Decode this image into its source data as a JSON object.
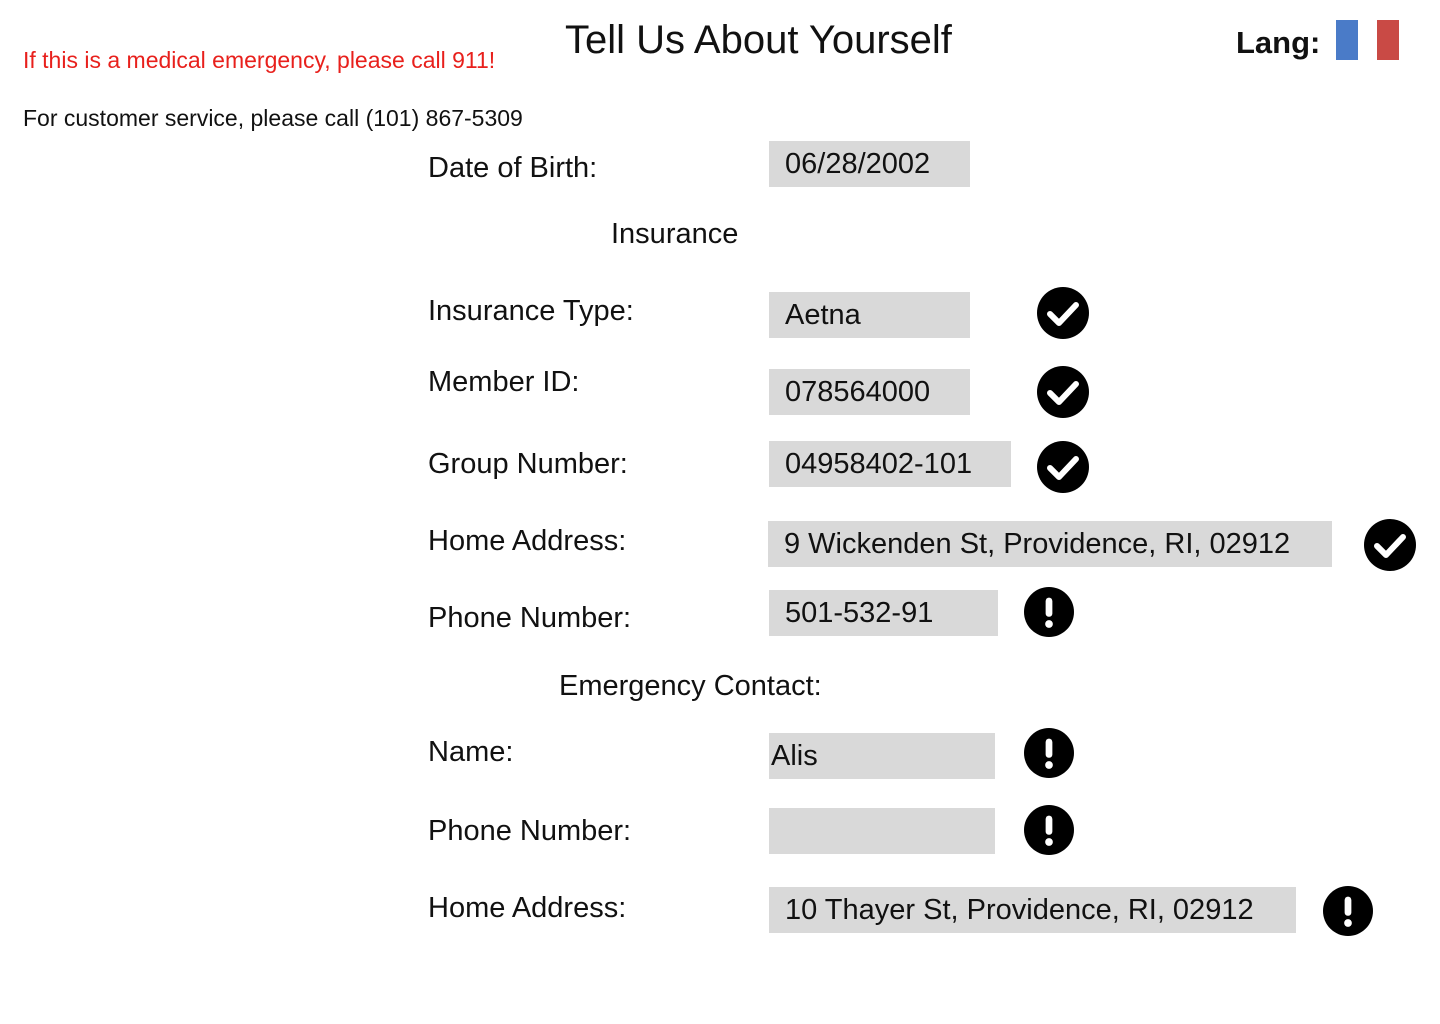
{
  "header": {
    "emergency_note": "If this is a medical emergency, please call 911!",
    "service_note": "For customer service, please call (101) 867-5309",
    "title": "Tell Us About Yourself",
    "lang_label": "Lang:",
    "lang_flags": [
      {
        "color": "#4a7bc8"
      },
      {
        "color": "#c94a45"
      }
    ]
  },
  "form": {
    "dob": {
      "label": "Date of Birth:",
      "value": "06/28/2002"
    },
    "insurance_heading": "Insurance",
    "insurance_type": {
      "label": "Insurance Type:",
      "value": "Aetna",
      "status": "check-circle-icon"
    },
    "member_id": {
      "label": "Member ID:",
      "value": "078564000",
      "status": "check-circle-icon"
    },
    "group_number": {
      "label": "Group Number:",
      "value": "04958402-101",
      "status": "check-circle-icon"
    },
    "home_address": {
      "label": "Home Address:",
      "value": "9 Wickenden St, Providence, RI, 02912",
      "status": "check-circle-icon"
    },
    "phone_number": {
      "label": "Phone Number:",
      "value": "501-532-91",
      "status": "exclamation-circle-icon"
    },
    "emergency_heading": "Emergency Contact:",
    "ec_name": {
      "label": "Name:",
      "value": "Alis",
      "status": "exclamation-circle-icon"
    },
    "ec_phone": {
      "label": "Phone Number:",
      "value": "",
      "status": "exclamation-circle-icon"
    },
    "ec_address": {
      "label": "Home Address:",
      "value": "10 Thayer St, Providence, RI, 02912",
      "status": "exclamation-circle-icon"
    }
  }
}
